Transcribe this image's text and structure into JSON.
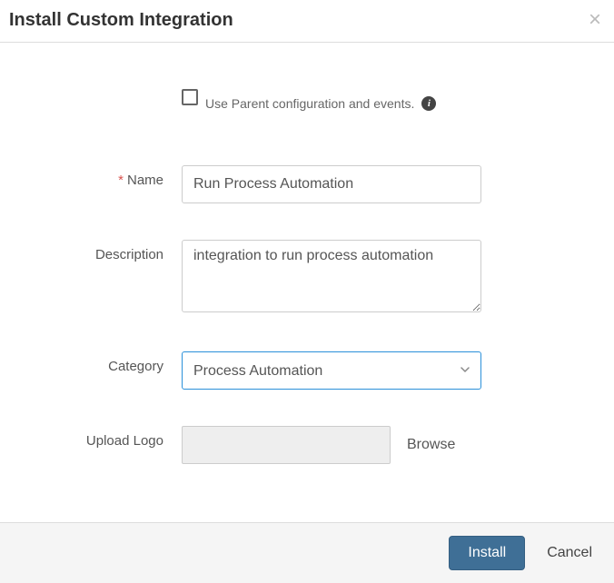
{
  "dialog": {
    "title": "Install Custom Integration"
  },
  "form": {
    "use_parent": {
      "label": "Use Parent configuration and events.",
      "checked": false
    },
    "name": {
      "label": "Name",
      "required": true,
      "value": "Run Process Automation"
    },
    "description": {
      "label": "Description",
      "value": "integration to run process automation"
    },
    "category": {
      "label": "Category",
      "selected": "Process Automation"
    },
    "upload_logo": {
      "label": "Upload Logo",
      "browse_label": "Browse"
    }
  },
  "footer": {
    "install_label": "Install",
    "cancel_label": "Cancel"
  }
}
